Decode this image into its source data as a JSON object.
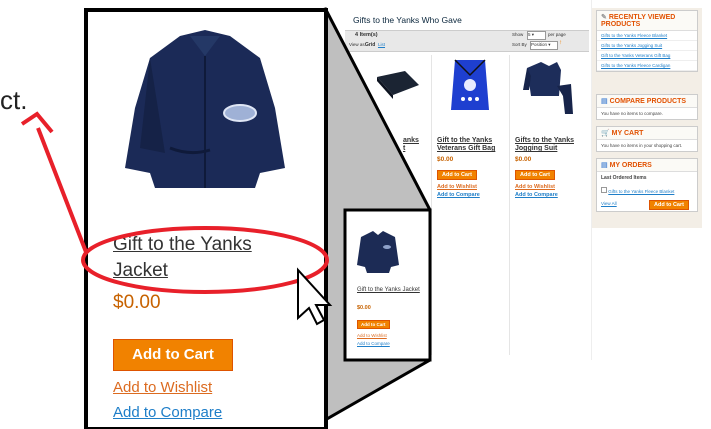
{
  "left_text": "ct.",
  "zoom": {
    "product_name": "Gift to the Yanks Jacket",
    "price": "$0.00",
    "add_to_cart": "Add to Cart",
    "add_to_wishlist": "Add to Wishlist",
    "add_to_compare": "Add to Compare"
  },
  "page": {
    "title": "Gifts to the Yanks Who Gave",
    "item_count": "4 Item(s)",
    "show_label": "Show",
    "show_value": "5",
    "per_page": "per page",
    "view_as": "View as:",
    "view_grid": "Grid",
    "view_list": "List",
    "sort_by": "Sort By",
    "sort_value": "Position"
  },
  "products": [
    {
      "name_partial": "anks",
      "name_partial2": "t"
    },
    {
      "name": "Gift to the Yanks Veterans Gift Bag",
      "price": "$0.00",
      "add_to_cart": "Add to Cart",
      "add_to_wishlist": "Add to Wishlist",
      "add_to_compare": "Add to Compare"
    },
    {
      "name": "Gifts to the Yanks Jogging Suit",
      "price": "$0.00",
      "add_to_cart": "Add to Cart",
      "add_to_wishlist": "Add to Wishlist",
      "add_to_compare": "Add to Compare"
    },
    {
      "name": "Gift to the Yanks Jacket",
      "price": "$0.00",
      "add_to_cart": "Add to Cart",
      "add_to_wishlist": "Add to Wishlist",
      "add_to_compare": "Add to Compare"
    }
  ],
  "sidebar": {
    "recently_viewed_title": "RECENTLY VIEWED PRODUCTS",
    "recently_viewed": [
      "Gifts to the Yanks Fleece Blanket",
      "Gifts to the Yanks Jogging Suit",
      "Gift to the Yanks Veterans Gift Bag",
      "Gifts to the Yanks Fleece Cardigan"
    ],
    "compare_title": "COMPARE PRODUCTS",
    "compare_text": "You have no items to compare.",
    "cart_title": "MY CART",
    "cart_text": "You have no items in your shopping cart.",
    "orders_title": "MY ORDERS",
    "orders_subtitle": "Last Ordered Items",
    "orders_item": "Gifts to the Yanks Fleece Blanket",
    "view_all": "View All",
    "orders_add_to_cart": "Add to Cart"
  },
  "colors": {
    "annotation_red": "#e8202a",
    "button_orange": "#f18200",
    "link_blue": "#1e7ec8",
    "heading_orange": "#e25203"
  }
}
